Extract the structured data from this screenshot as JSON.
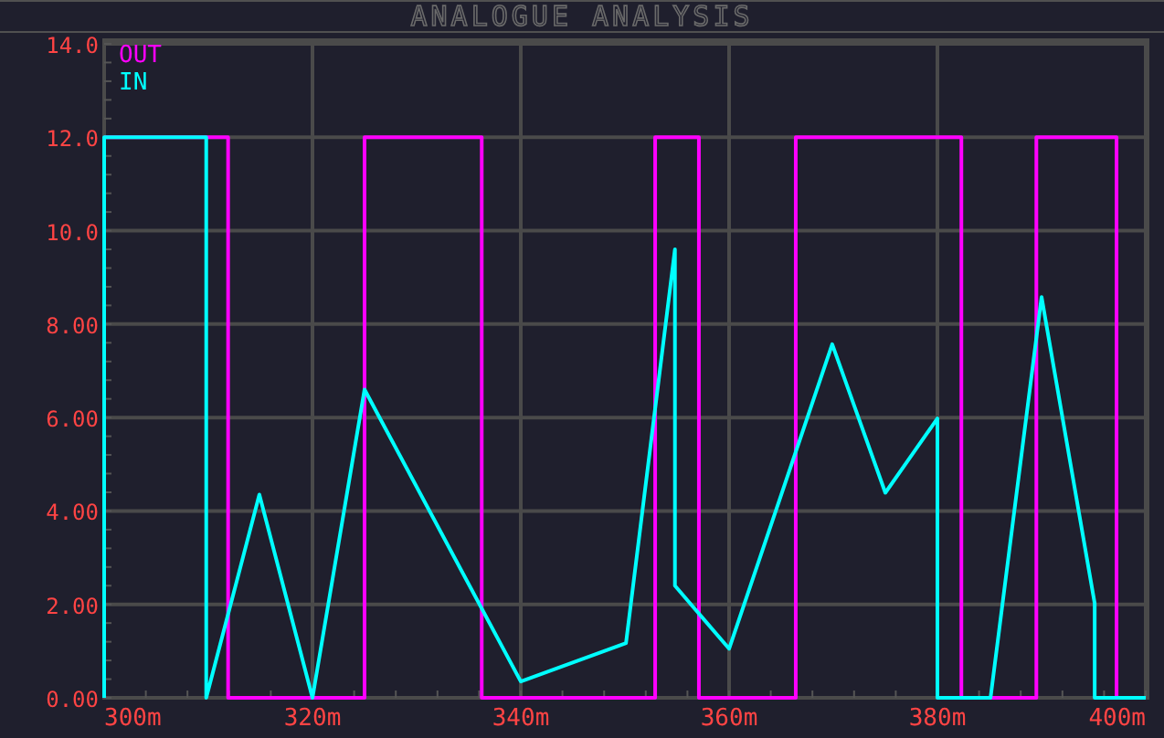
{
  "window": {
    "title": "ANALOGUE ANALYSIS"
  },
  "graph": {
    "chart_data": {
      "type": "line",
      "grid": true,
      "xlim": [
        300,
        400
      ],
      "ylim": [
        0,
        14
      ],
      "xticks": [
        {
          "value": 300,
          "label": "300m"
        },
        {
          "value": 320,
          "label": "320m"
        },
        {
          "value": 340,
          "label": "340m"
        },
        {
          "value": 360,
          "label": "360m"
        },
        {
          "value": 380,
          "label": "380m"
        },
        {
          "value": 400,
          "label": "400m"
        }
      ],
      "yticks": [
        {
          "value": 0,
          "label": "0.00"
        },
        {
          "value": 2,
          "label": "2.00"
        },
        {
          "value": 4,
          "label": "4.00"
        },
        {
          "value": 6,
          "label": "6.00"
        },
        {
          "value": 8,
          "label": "8.00"
        },
        {
          "value": 10,
          "label": "10.0"
        },
        {
          "value": 12,
          "label": "12.0"
        },
        {
          "value": 14,
          "label": "14.0"
        }
      ],
      "series": [
        {
          "name": "OUT",
          "color": "#ff00ff",
          "x": [
            300,
            311.9,
            311.9,
            325,
            325,
            336.25,
            336.25,
            352.9,
            352.9,
            357.1,
            357.1,
            366.4,
            366.4,
            382.3,
            382.3,
            389.5,
            389.5,
            397.2,
            397.2,
            400
          ],
          "values": [
            12,
            12,
            0,
            0,
            12,
            12,
            0,
            0,
            12,
            12,
            0,
            0,
            12,
            12,
            0,
            0,
            12,
            12,
            0,
            0
          ]
        },
        {
          "name": "IN",
          "color": "#00ffff",
          "x": [
            300,
            300,
            309.8,
            309.8,
            314.9,
            320,
            325,
            340,
            350.1,
            354.8,
            354.8,
            360,
            369.9,
            375,
            380,
            380,
            385.1,
            390,
            395.1,
            395.1,
            400
          ],
          "values": [
            0,
            12,
            12,
            0,
            4.35,
            0,
            6.6,
            0.35,
            1.17,
            9.6,
            2.4,
            1.05,
            7.57,
            4.39,
            5.98,
            0,
            0,
            8.58,
            2.02,
            0,
            0
          ]
        }
      ]
    }
  }
}
